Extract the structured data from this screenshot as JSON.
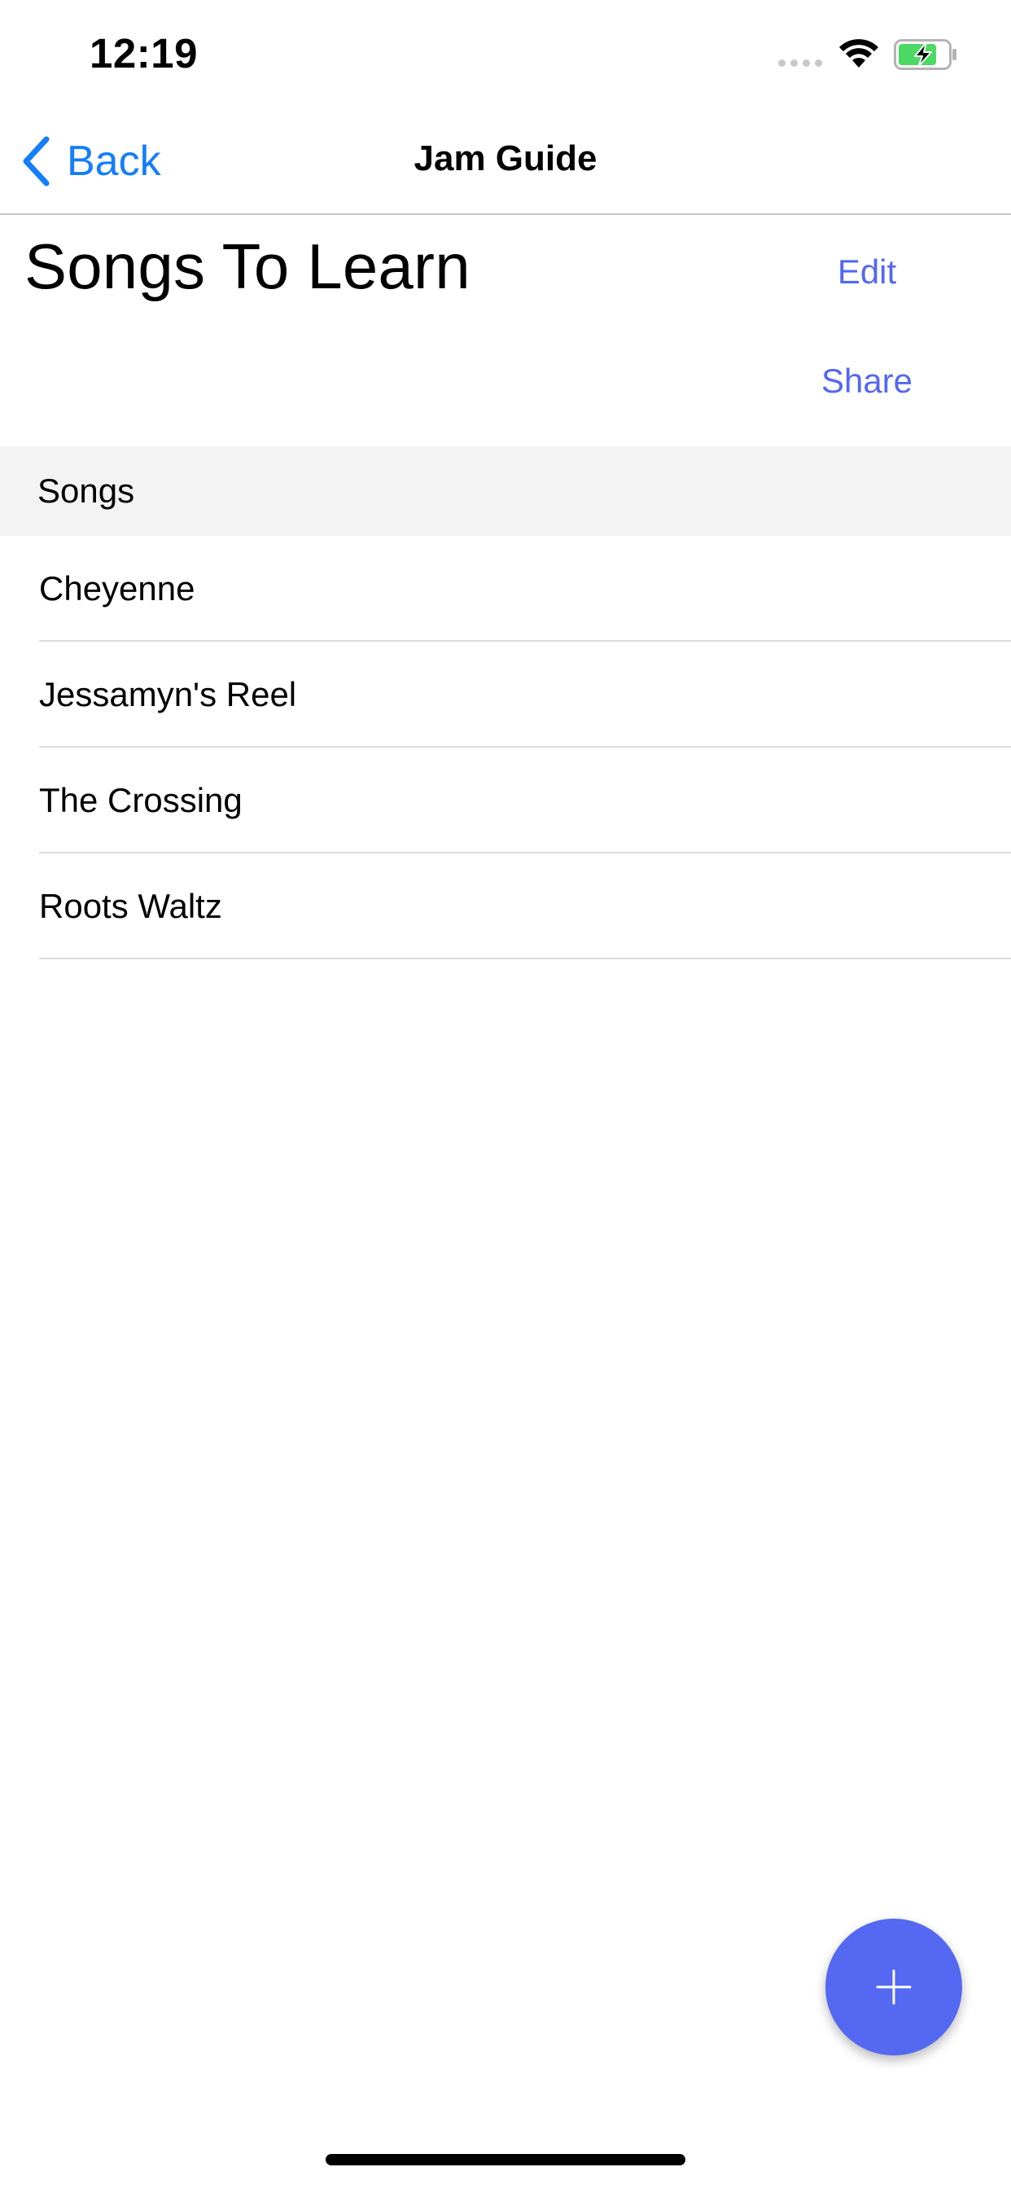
{
  "status_bar": {
    "time": "12:19",
    "icons": [
      "signal-dots-icon",
      "wifi-icon",
      "battery-charging-icon"
    ]
  },
  "nav": {
    "back_label": "Back",
    "title": "Jam Guide"
  },
  "header": {
    "title": "Songs To Learn",
    "edit_label": "Edit",
    "share_label": "Share"
  },
  "section": {
    "title": "Songs"
  },
  "songs": [
    {
      "title": "Cheyenne"
    },
    {
      "title": "Jessamyn's Reel"
    },
    {
      "title": "The Crossing"
    },
    {
      "title": "Roots Waltz"
    }
  ],
  "fab": {
    "icon": "plus-icon"
  },
  "colors": {
    "ios_blue": "#147efb",
    "accent": "#5468f1",
    "section_bg": "#f3f3f3",
    "separator": "#dcdcdc",
    "battery_green": "#4cd964"
  }
}
